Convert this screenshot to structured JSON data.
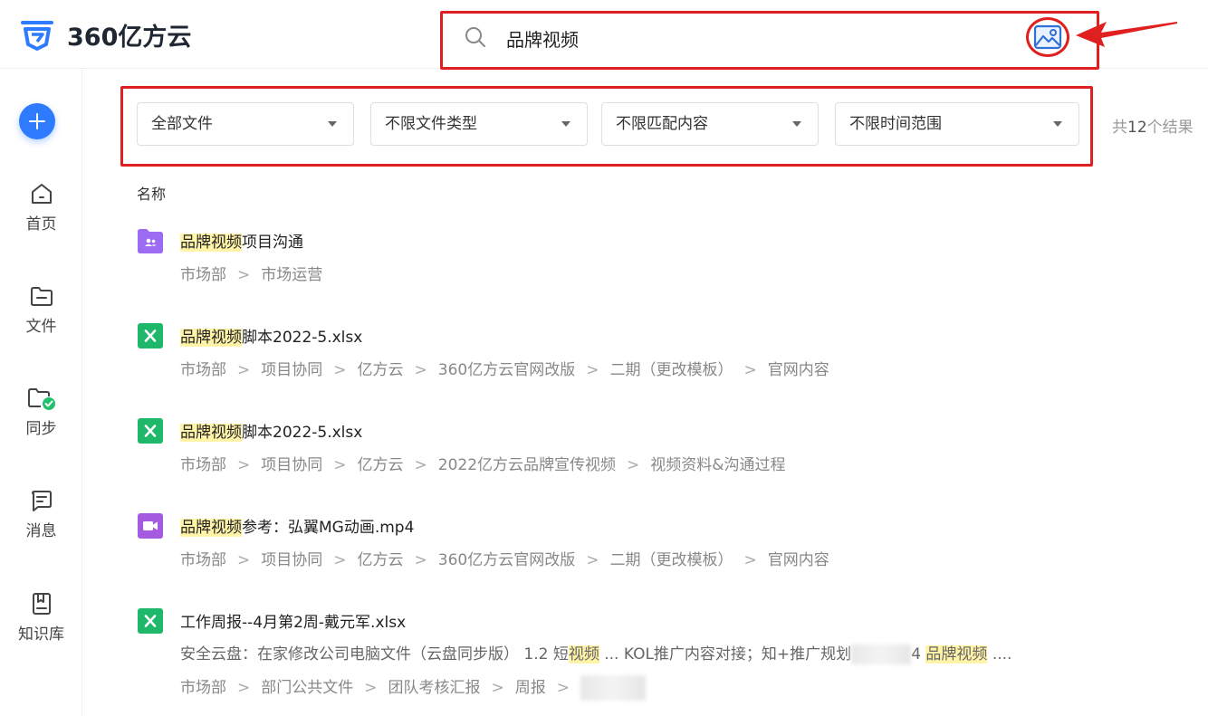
{
  "app": {
    "logo_text": "360亿方云",
    "brand_color": "#2f7bff"
  },
  "search": {
    "query": "品牌视频"
  },
  "sidebar": {
    "items": [
      {
        "label": "首页",
        "icon": "home-icon"
      },
      {
        "label": "文件",
        "icon": "folder-icon"
      },
      {
        "label": "同步",
        "icon": "sync-folder-icon"
      },
      {
        "label": "消息",
        "icon": "message-icon"
      },
      {
        "label": "知识库",
        "icon": "knowledge-base-icon"
      }
    ]
  },
  "filters": {
    "scope": "全部文件",
    "type": "不限文件类型",
    "match": "不限匹配内容",
    "time": "不限时间范围",
    "result_prefix": "共",
    "result_count": "12",
    "result_suffix": "个结果"
  },
  "list": {
    "header": "名称",
    "files": [
      {
        "icon": "shared-folder-icon",
        "highlight": "品牌视频",
        "rest": "项目沟通",
        "path": [
          "市场部",
          "市场运营"
        ]
      },
      {
        "icon": "excel-icon",
        "highlight": "品牌视频",
        "rest": "脚本2022-5.xlsx",
        "path": [
          "市场部",
          "项目协同",
          "亿方云",
          "360亿方云官网改版",
          "二期（更改模板）",
          "官网内容"
        ]
      },
      {
        "icon": "excel-icon",
        "highlight": "品牌视频",
        "rest": "脚本2022-5.xlsx",
        "path": [
          "市场部",
          "项目协同",
          "亿方云",
          "2022亿方云品牌宣传视频",
          "视频资料&沟通过程"
        ]
      },
      {
        "icon": "video-icon",
        "highlight": "品牌视频",
        "rest": "参考：弘翼MG动画.mp4",
        "path": [
          "市场部",
          "项目协同",
          "亿方云",
          "360亿方云官网改版",
          "二期（更改模板）",
          "官网内容"
        ]
      },
      {
        "icon": "excel-icon",
        "name": "工作周报--4月第2周-戴元军.xlsx",
        "snippet": {
          "a": "安全云盘：在家修改公司电脑文件（云盘同步版） 1.2 短",
          "b": "视频",
          "c": " ... KOL推广内容对接；知+推广规划",
          "d": "4 ",
          "e": "品牌视频",
          "f": " ...."
        },
        "path": [
          "市场部",
          "部门公共文件",
          "团队考核汇报",
          "周报"
        ]
      }
    ]
  }
}
